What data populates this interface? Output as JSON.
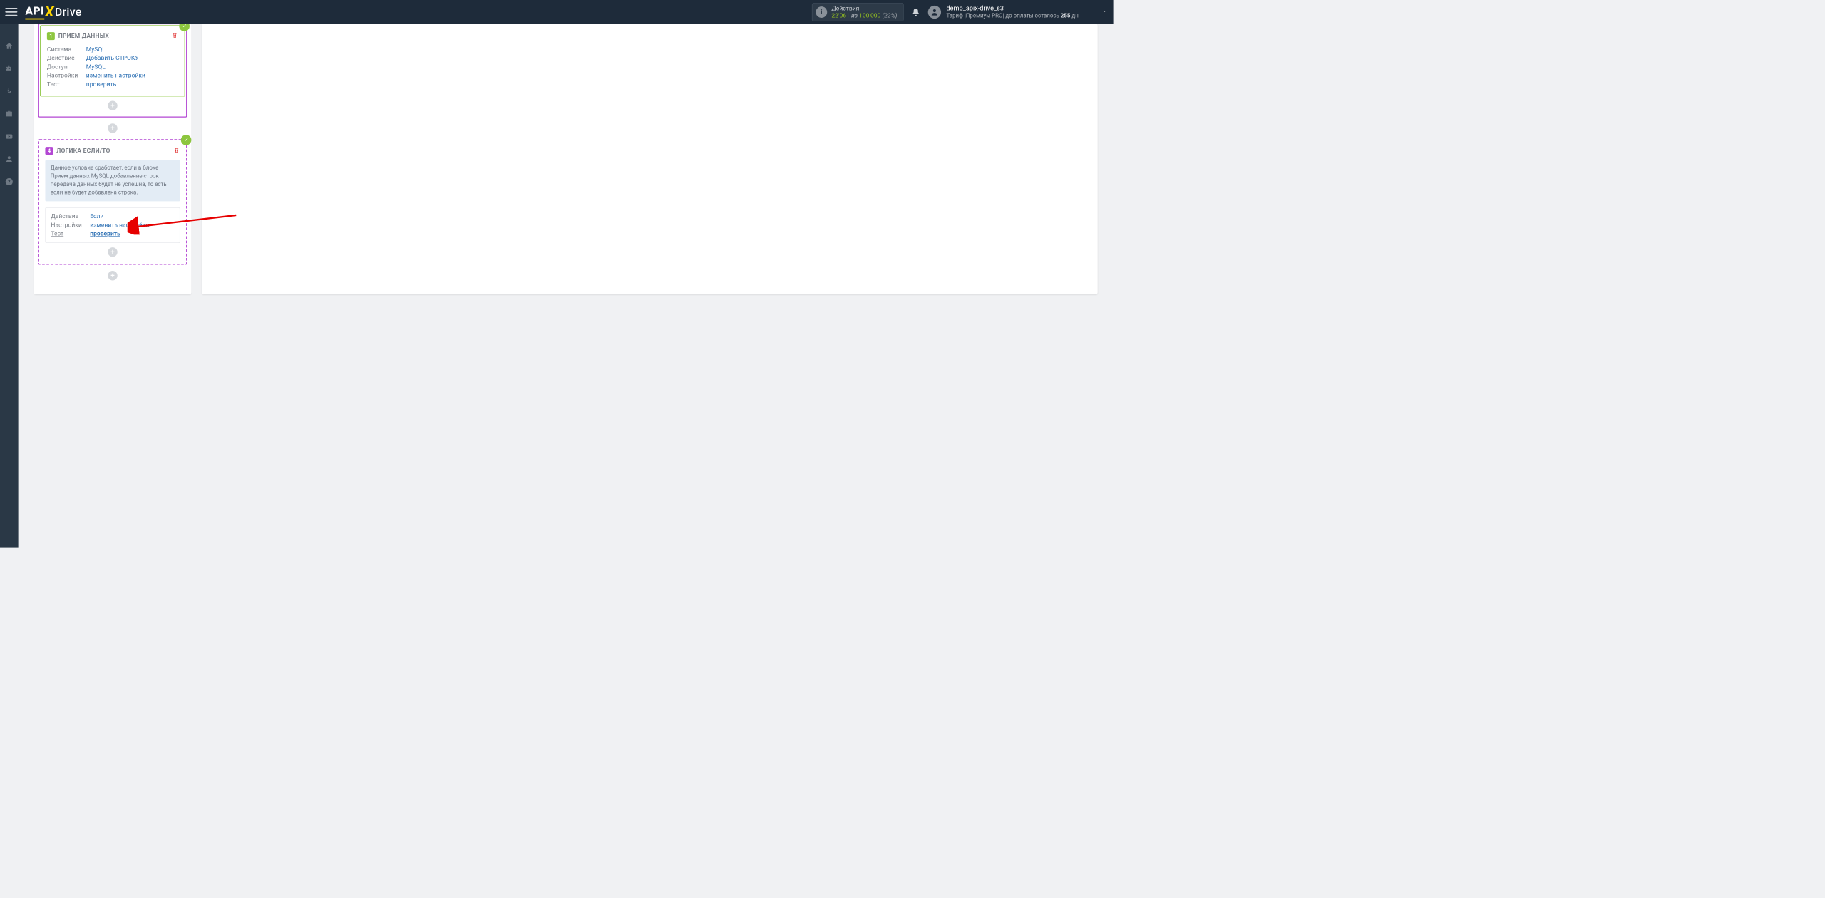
{
  "topbar": {
    "logo_api": "API",
    "logo_drive": "Drive",
    "actions_label": "Действия:",
    "actions_used": "22'061",
    "actions_of": " из ",
    "actions_total": "100'000",
    "actions_pct": " (22%)",
    "user_name": "demo_apix-drive_s3",
    "user_sub_prefix": "Тариф |Премиум PRO| до оплаты осталось ",
    "user_sub_days": "255",
    "user_sub_suffix": " дн"
  },
  "block1": {
    "step": "1",
    "title": "ПРИЕМ ДАННЫХ",
    "rows": {
      "system_lbl": "Система",
      "system_val": "MySQL",
      "action_lbl": "Действие",
      "action_val": "Добавить СТРОКУ",
      "access_lbl": "Доступ",
      "access_val": "MySQL",
      "settings_lbl": "Настройки",
      "settings_val": "изменить настройки",
      "test_lbl": "Тест",
      "test_val": "проверить"
    }
  },
  "block4": {
    "step": "4",
    "title": "ЛОГИКА ЕСЛИ/ТО",
    "desc": "Данное условие сработает, если в блоке Прием данных MySQL добавление строк передача данных будет не успешна, то есть если не будет добавлена строка.",
    "rows": {
      "action_lbl": "Действие",
      "action_val": "Если",
      "settings_lbl": "Настройки",
      "settings_val": "изменить настройки",
      "test_lbl": "Тест",
      "test_val": "проверить"
    }
  }
}
